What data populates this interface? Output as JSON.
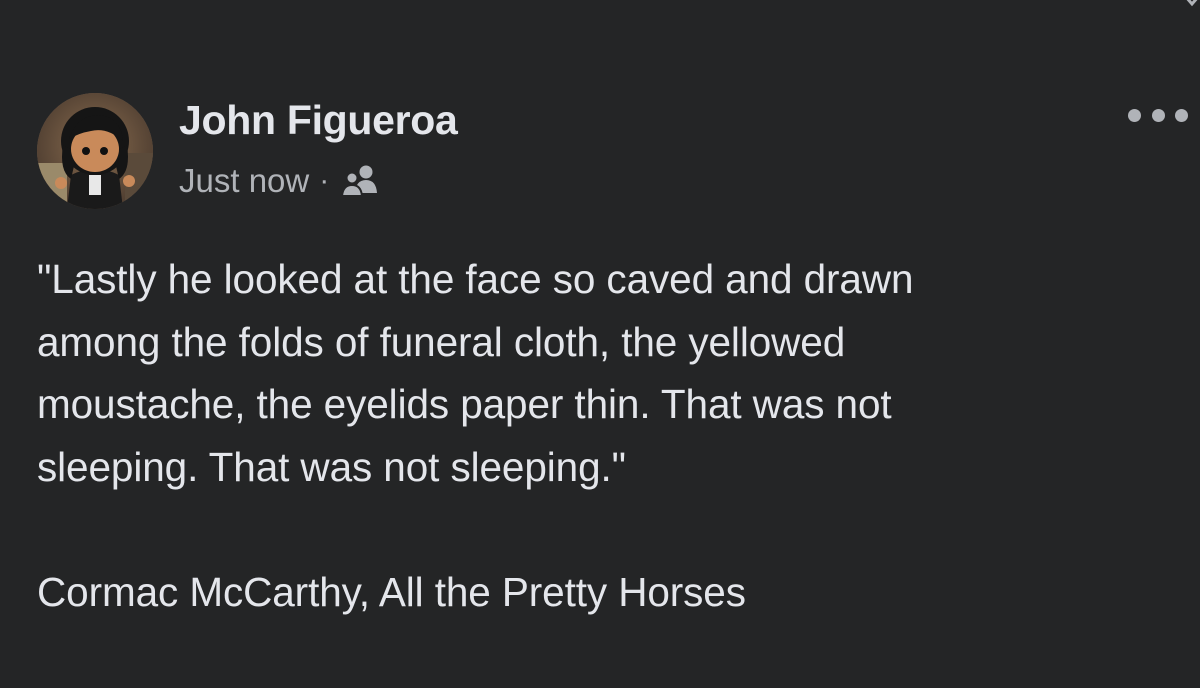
{
  "post": {
    "author": "John Figueroa",
    "timestamp": "Just now",
    "separator": "·",
    "audience_icon": "friends-icon",
    "more_icon": "more-options-icon",
    "quote_lines": [
      "\"Lastly he looked at the face so caved and drawn",
      "among the folds of funeral cloth, the yellowed",
      "moustache, the eyelids paper thin. That was not",
      "sleeping. That was not sleeping.\""
    ],
    "attribution": "Cormac McCarthy, All the Pretty Horses"
  },
  "colors": {
    "background": "#242526",
    "primary_text": "#e4e6eb",
    "secondary_text": "#b0b3b8"
  }
}
